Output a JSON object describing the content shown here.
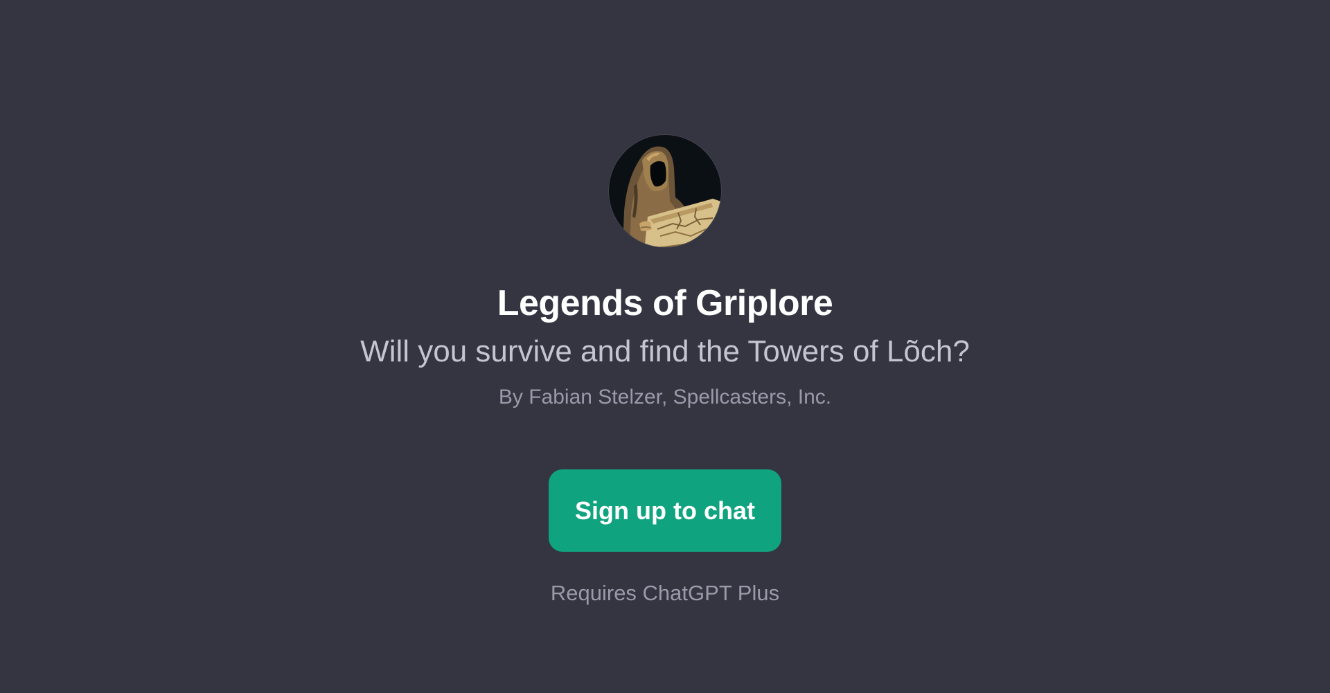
{
  "gpt": {
    "avatar_icon": "hooded-figure-reading-map-icon",
    "title": "Legends of Griplore",
    "description": "Will you survive and find the Towers of Lõch?",
    "author": "By Fabian Stelzer, Spellcasters, Inc."
  },
  "cta": {
    "label": "Sign up to chat",
    "color": "#10a37f"
  },
  "requirement_note": "Requires ChatGPT Plus",
  "colors": {
    "background": "#343541",
    "title": "#ffffff",
    "subtitle": "#c5c5d2",
    "muted": "#9a9aab"
  }
}
